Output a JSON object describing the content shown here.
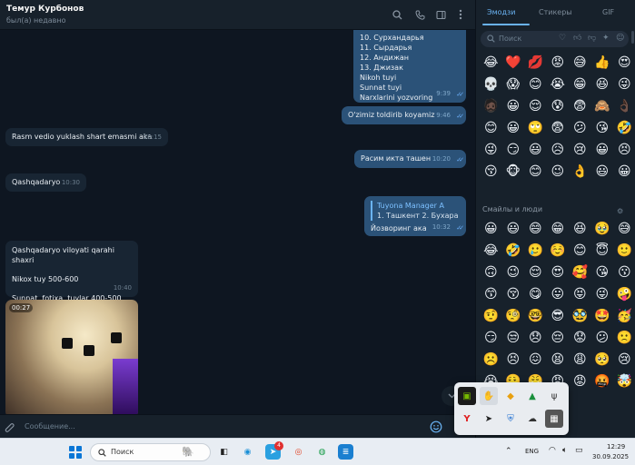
{
  "header": {
    "contact_name": "Темур Курбонов",
    "status": "был(а) недавно"
  },
  "messages": {
    "list_out": {
      "lines": [
        "10. Сурхандарья",
        "11. Сырдарья",
        "12. Андижан",
        "13. Джизак",
        "Nikoh tuyi",
        "Sunnat tuyi",
        "Narxlarini yozvoring"
      ],
      "time": "9:39"
    },
    "out_fill": {
      "text": "O'zimiz toldirib koyamiz",
      "time": "9:46"
    },
    "in_rasm": {
      "text": "Rasm vedio yuklash shart emasmi aka",
      "time": "10:15"
    },
    "out_photo_req": {
      "text": "Расим икта ташен",
      "time": "10:20"
    },
    "in_region": {
      "text": "Qashqadaryo",
      "time": "10:30"
    },
    "out_reply": {
      "quote_title": "Tuyona Manager A",
      "quote_text": "1. Ташкент 2. Бухара ...",
      "text": "Йозворинг ака",
      "time": "10:32"
    },
    "in_prices": {
      "line1": "Qashqadaryo viloyati qarahi shaxri",
      "line2": "Nikox tuy  500-600",
      "line3": "Sunnat, fotixa, tuylar 400-500",
      "time": "10:40"
    },
    "photo_duration": "00:27"
  },
  "input": {
    "placeholder": "Сообщение..."
  },
  "emoji_panel": {
    "tabs": [
      "Эмодзи",
      "Стикеры",
      "GIF"
    ],
    "search_placeholder": "Поиск",
    "section_label": "Смайлы и люди",
    "recent": [
      "😂",
      "❤️",
      "💋",
      "😡",
      "😅",
      "👍",
      "😍",
      "💀",
      "😱",
      "😊",
      "😭",
      "😁",
      "😆",
      "😜",
      "🧔🏿",
      "😀",
      "😌",
      "😰",
      "😨",
      "🙈",
      "👌🏿",
      "😊",
      "😀",
      "🙄",
      "😨",
      "😕",
      "😘",
      "🤣",
      "😜",
      "😏",
      "😃",
      "😥",
      "😢",
      "😀",
      "😣",
      "😚",
      "🐵",
      "😊",
      "😉",
      "👌",
      "😃",
      "😀"
    ],
    "smileys": [
      "😀",
      "😃",
      "😄",
      "😁",
      "😆",
      "🥹",
      "😅",
      "😂",
      "🤣",
      "🥲",
      "☺️",
      "😊",
      "😇",
      "🙂",
      "🙃",
      "😉",
      "😌",
      "😍",
      "🥰",
      "😘",
      "😗",
      "😙",
      "😚",
      "😋",
      "😛",
      "😝",
      "😜",
      "🤪",
      "🤨",
      "🧐",
      "🤓",
      "😎",
      "🥸",
      "🤩",
      "🥳",
      "😏",
      "😒",
      "😞",
      "😔",
      "😟",
      "😕",
      "🙁",
      "☹️",
      "😣",
      "😖",
      "😫",
      "😩",
      "🥺",
      "😢",
      "😭",
      "😮‍💨",
      "😤",
      "😠",
      "😡",
      "🤬",
      "🤯"
    ]
  },
  "tray": {
    "icons": [
      "nvidia-icon",
      "cursor-app-icon",
      "layers-icon",
      "drive-icon",
      "usb-icon",
      "yandex-icon",
      "telegram-icon",
      "shield-icon",
      "cloud-icon",
      "app-icon"
    ]
  },
  "taskbar": {
    "search_text": "Поиск",
    "language": "ENG",
    "time": "12:29",
    "date": "30.09.2025",
    "badge_count": "4"
  }
}
